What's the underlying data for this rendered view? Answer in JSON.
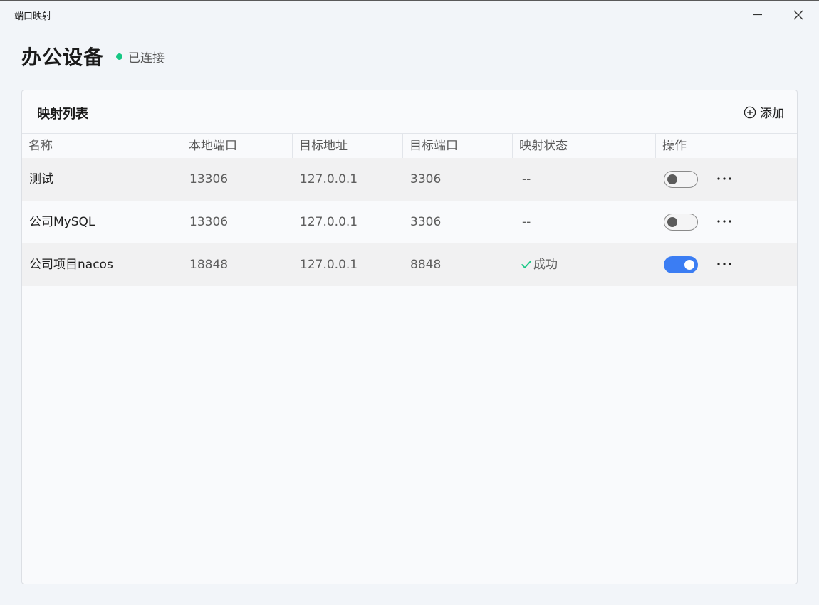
{
  "window": {
    "title": "端口映射"
  },
  "device": {
    "name": "办公设备",
    "status": "已连接",
    "status_color": "#16c784"
  },
  "panel": {
    "title": "映射列表",
    "add_label": "添加"
  },
  "table": {
    "headers": [
      "名称",
      "本地端口",
      "目标地址",
      "目标端口",
      "映射状态",
      "操作"
    ],
    "rows": [
      {
        "name": "测试",
        "local_port": "13306",
        "target_addr": "127.0.0.1",
        "target_port": "3306",
        "status": "--",
        "enabled": false
      },
      {
        "name": "公司MySQL",
        "local_port": "13306",
        "target_addr": "127.0.0.1",
        "target_port": "3306",
        "status": "--",
        "enabled": false
      },
      {
        "name": "公司项目nacos",
        "local_port": "18848",
        "target_addr": "127.0.0.1",
        "target_port": "8848",
        "status": "成功",
        "enabled": true
      }
    ]
  },
  "colors": {
    "accent": "#3b7df3",
    "success": "#16c784"
  },
  "icons": {
    "minimize": "minimize-icon",
    "close": "close-icon",
    "add": "plus-circle-icon",
    "more": "more-dots-icon",
    "success": "check-icon"
  }
}
